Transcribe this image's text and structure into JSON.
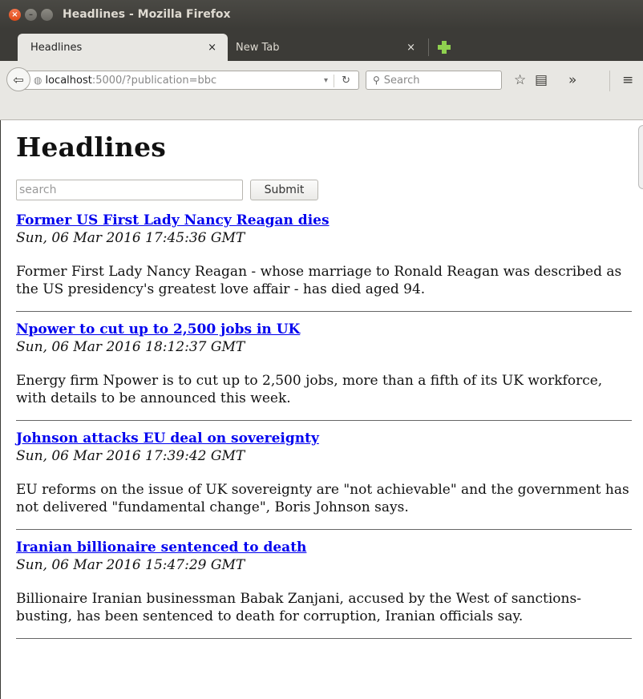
{
  "window": {
    "title": "Headlines - Mozilla Firefox"
  },
  "tabs": [
    {
      "label": "Headlines",
      "close": "×"
    },
    {
      "label": "New Tab",
      "close": "×"
    }
  ],
  "navbar": {
    "url_host": "localhost",
    "url_rest": ":5000/?publication=bbc",
    "search_placeholder": "Search"
  },
  "page": {
    "heading": "Headlines",
    "search_placeholder": "search",
    "submit_label": "Submit",
    "articles": [
      {
        "title": "Former US First Lady Nancy Reagan dies",
        "date": "Sun, 06 Mar 2016 17:45:36 GMT",
        "summary": "Former First Lady Nancy Reagan - whose marriage to Ronald Reagan was described as the US presidency's greatest love affair - has died aged 94."
      },
      {
        "title": "Npower to cut up to 2,500 jobs in UK",
        "date": "Sun, 06 Mar 2016 18:12:37 GMT",
        "summary": "Energy firm Npower is to cut up to 2,500 jobs, more than a fifth of its UK workforce, with details to be announced this week."
      },
      {
        "title": "Johnson attacks EU deal on sovereignty",
        "date": "Sun, 06 Mar 2016 17:39:42 GMT",
        "summary": "EU reforms on the issue of UK sovereignty are \"not achievable\" and the government has not delivered \"fundamental change\", Boris Johnson says."
      },
      {
        "title": "Iranian billionaire sentenced to death",
        "date": "Sun, 06 Mar 2016 15:47:29 GMT",
        "summary": "Billionaire Iranian businessman Babak Zanjani, accused by the West of sanctions-busting, has been sentenced to death for corruption, Iranian officials say."
      }
    ]
  }
}
